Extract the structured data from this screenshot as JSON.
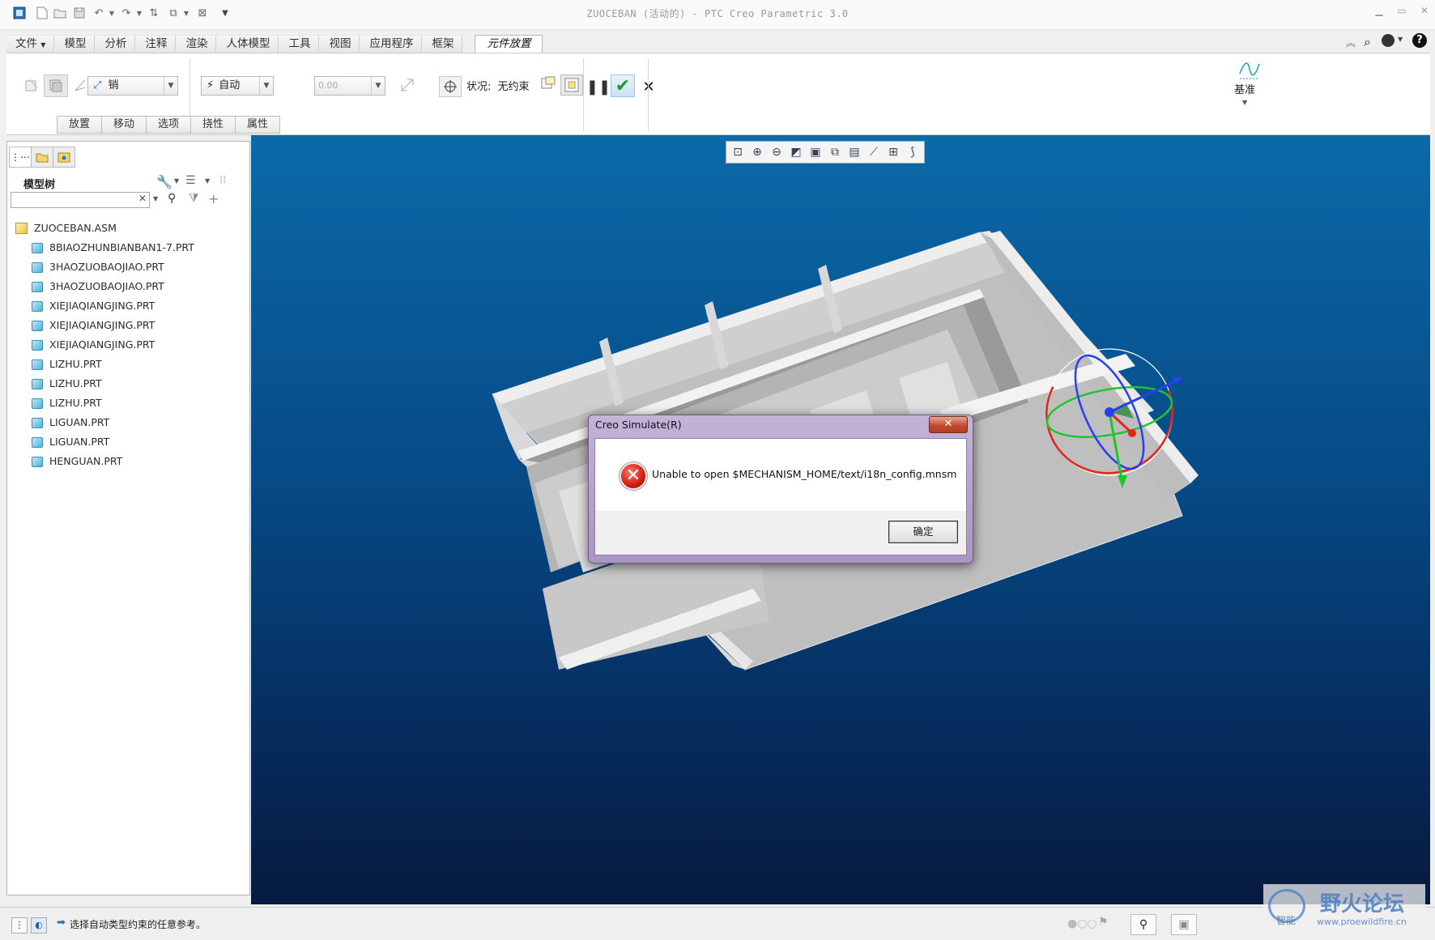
{
  "window": {
    "title": "ZUOCEBAN (活动的) - PTC Creo Parametric 3.0"
  },
  "menubar": {
    "items": [
      "文件",
      "模型",
      "分析",
      "注释",
      "渲染",
      "人体模型",
      "工具",
      "视图",
      "应用程序",
      "框架",
      "元件放置"
    ],
    "active_index": 10
  },
  "ribbon": {
    "constraint_type": "销",
    "offset_type": "自动",
    "offset_value": "0.00",
    "status_label": "状况:",
    "status_value": "无约束",
    "datum_label": "基准"
  },
  "subtabs": [
    "放置",
    "移动",
    "选项",
    "挠性",
    "属性"
  ],
  "model_tree": {
    "title": "模型树",
    "search_placeholder": "",
    "root": "ZUOCEBAN.ASM",
    "items": [
      "8BIAOZHUNBIANBAN1-7.PRT",
      "3HAOZUOBAOJIAO.PRT",
      "3HAOZUOBAOJIAO.PRT",
      "XIEJIAQIANGJING.PRT",
      "XIEJIAQIANGJING.PRT",
      "XIEJIAQIANGJING.PRT",
      "LIZHU.PRT",
      "LIZHU.PRT",
      "LIZHU.PRT",
      "LIGUAN.PRT",
      "LIGUAN.PRT",
      "HENGUAN.PRT"
    ]
  },
  "dialog": {
    "title": "Creo Simulate(R)",
    "message": "Unable to open $MECHANISM_HOME/text/i18n_config.mnsm",
    "ok_label": "确定"
  },
  "statusbar": {
    "message": "选择自动类型约束的任意参考。"
  },
  "watermark": {
    "name": "野火论坛",
    "sub": "智能",
    "url": "www.proewildfire.cn"
  },
  "colors": {
    "viewport_top": "#0b6aa8",
    "viewport_bottom": "#071a3f",
    "dialog_frame": "#a995c2",
    "confirm_green": "#1e9d2e"
  }
}
